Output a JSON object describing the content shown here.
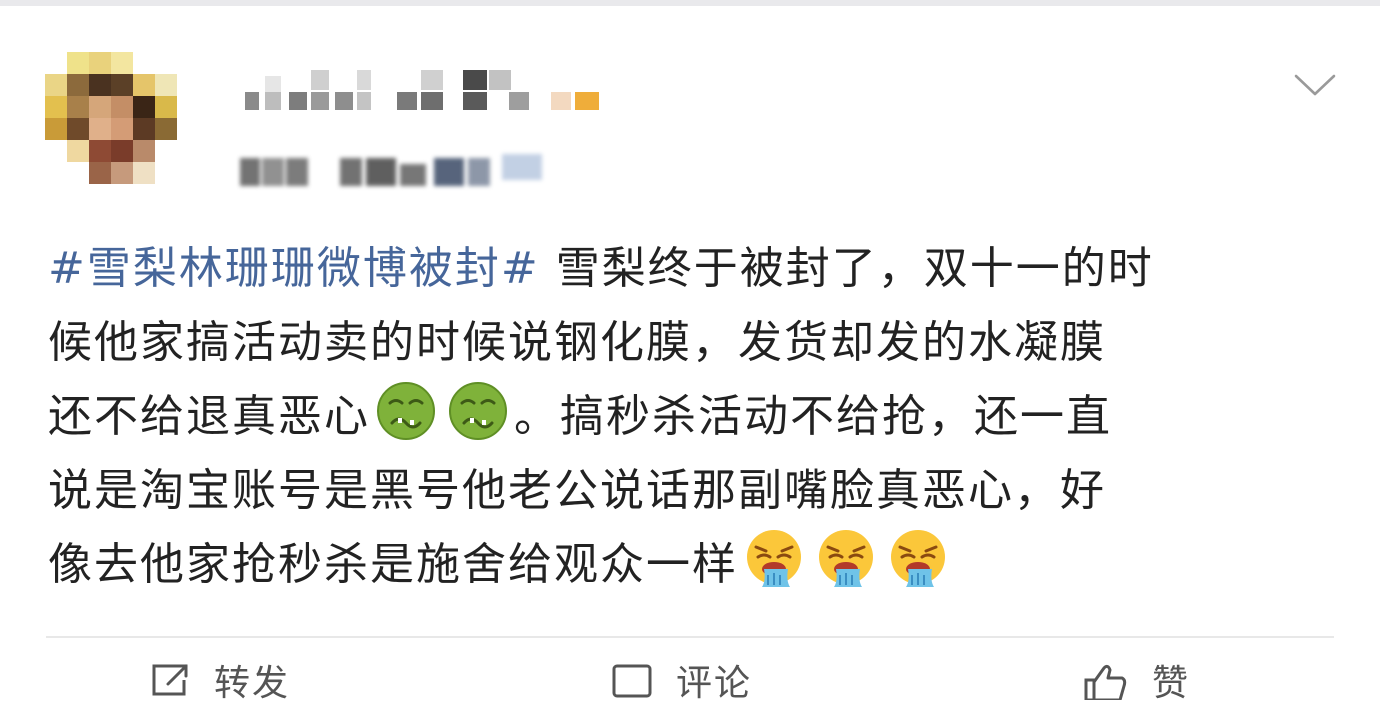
{
  "post": {
    "hashtag": "#雪梨林珊珊微博被封#",
    "line1_text": " 雪梨终于被封了，双十一的时",
    "line2_text": "候他家搞活动卖的时候说钢化膜，发货却发的水凝膜",
    "line3_text_before": "还不给退真恶心",
    "line3_text_after": "。搞秒杀活动不给抢，还一直",
    "line4_text": "说是淘宝账号是黑号他老公说话那副嘴脸真恶心，好",
    "line5_text": "像去他家抢秒杀是施舍给观众一样"
  },
  "emojis": {
    "sick": "nauseated-face-emoji",
    "puke": "vomiting-face-emoji"
  },
  "actions": {
    "repost_label": "转发",
    "comment_label": "评论",
    "like_label": "赞"
  },
  "colors": {
    "hashtag": "#46669a",
    "text": "#222222",
    "divider": "#e8e8e8"
  }
}
